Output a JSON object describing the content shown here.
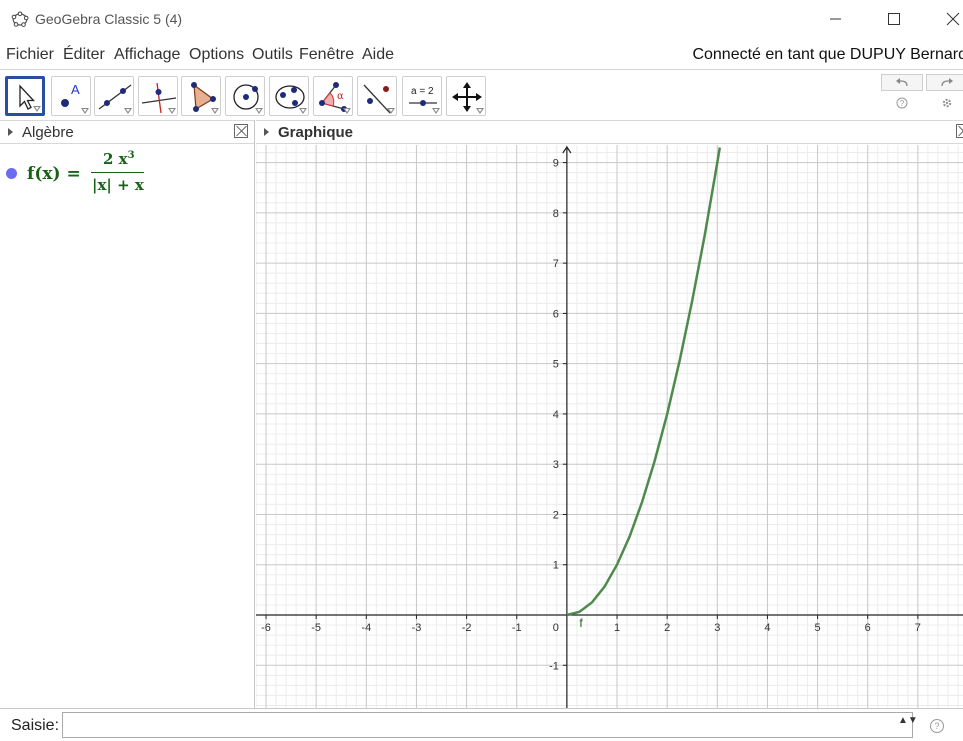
{
  "window": {
    "title": "GeoGebra Classic 5 (4)"
  },
  "menu": {
    "items": [
      "Fichier",
      "Éditer",
      "Affichage",
      "Options",
      "Outils",
      "Fenêtre",
      "Aide"
    ],
    "user_status": "Connecté en tant que DUPUY Bernard"
  },
  "toolbar": {
    "tools": [
      {
        "icon": "move-pointer-icon",
        "selected": true
      },
      {
        "icon": "point-icon"
      },
      {
        "icon": "line-icon"
      },
      {
        "icon": "perpendicular-line-icon"
      },
      {
        "icon": "polygon-icon"
      },
      {
        "icon": "circle-center-point-icon"
      },
      {
        "icon": "conic-five-points-icon"
      },
      {
        "icon": "angle-icon"
      },
      {
        "icon": "reflect-icon"
      },
      {
        "icon": "slider-icon",
        "label": "a = 2"
      },
      {
        "icon": "move-graphics-view-icon"
      }
    ],
    "undo_icon": "undo-icon",
    "redo_icon": "redo-icon",
    "help_icon": "help-icon",
    "settings_icon": "gear-icon",
    "alpha_label": "α"
  },
  "algebra": {
    "title": "Algèbre",
    "entries": [
      {
        "lhs": "f(x) =",
        "numerator": "2 x",
        "exponent": "3",
        "denominator": "|x| + x",
        "color": "#166316",
        "dot_color": "#6b6bf0"
      }
    ]
  },
  "graphics": {
    "title": "Graphique",
    "function_label": "f",
    "origin_label": "0",
    "curve_color": "#4e8a4e",
    "grid_color": "#c8c8c8",
    "minor_grid_color": "#ececec"
  },
  "chart_data": {
    "type": "line",
    "title": "",
    "xlabel": "",
    "ylabel": "",
    "xlim": [
      -6.2,
      7.9
    ],
    "ylim": [
      -1.85,
      9.35
    ],
    "grid": true,
    "xticks": [
      -6,
      -5,
      -4,
      -3,
      -2,
      -1,
      1,
      2,
      3,
      4,
      5,
      6,
      7
    ],
    "yticks": [
      -1,
      1,
      2,
      3,
      4,
      5,
      6,
      7,
      8,
      9
    ],
    "series": [
      {
        "name": "f",
        "x": [
          0,
          0.25,
          0.5,
          0.75,
          1,
          1.25,
          1.5,
          1.75,
          2,
          2.25,
          2.5,
          2.75,
          3,
          3.05
        ],
        "y": [
          0,
          0.0625,
          0.25,
          0.5625,
          1,
          1.5625,
          2.25,
          3.0625,
          4,
          5.0625,
          6.25,
          7.5625,
          9,
          9.3
        ]
      }
    ]
  },
  "input_bar": {
    "label": "Saisie:",
    "value": "",
    "spinner": "▲▼",
    "help": "?"
  }
}
